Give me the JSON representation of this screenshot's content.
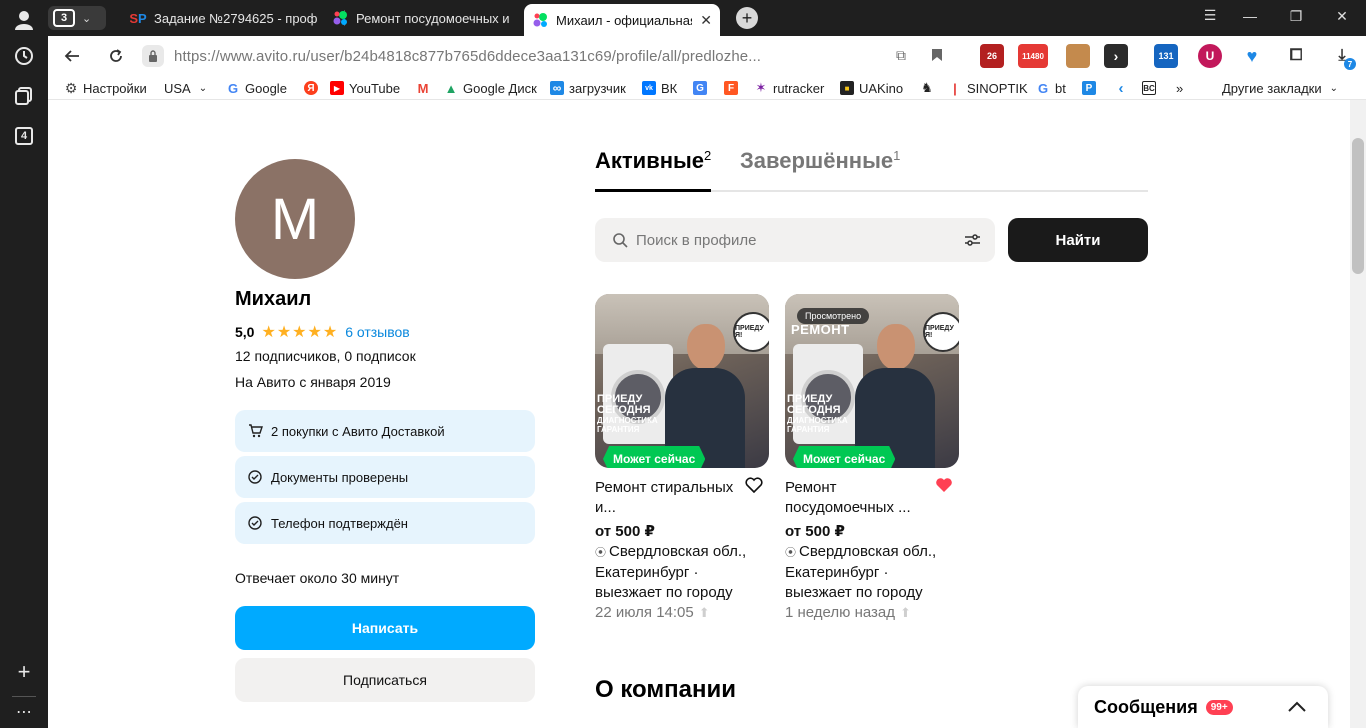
{
  "browser": {
    "sidebar": {
      "tab_group_count": "4"
    },
    "tab_count": "3",
    "tabs": [
      {
        "title": "Задание №2794625 - проф",
        "favicon": "SP"
      },
      {
        "title": "Ремонт посудомоечных и",
        "favicon": "avito"
      },
      {
        "title": "Михаил - официальная с",
        "favicon": "avito",
        "close": "✕"
      }
    ],
    "url": "https://www.avito.ru/user/b24b4818c877b765d6ddece3aa131c69/profile/all/predlozhe...",
    "extensions": [
      {
        "name": "badge-26",
        "text": "26",
        "color": "#b32020"
      },
      {
        "name": "badge-11480",
        "text": "11480",
        "color": "#e53935"
      },
      {
        "name": "ext-box",
        "text": "",
        "color": "#c48a4d"
      },
      {
        "name": "ext-arrow",
        "text": "›",
        "color": "#2b2b2b"
      },
      {
        "name": "ext-calendar",
        "text": "131",
        "color": "#1565c0"
      },
      {
        "name": "ext-ublock",
        "text": "U",
        "color": "#c2185b"
      },
      {
        "name": "ext-heart",
        "text": "♥",
        "color": "#1e88e5"
      },
      {
        "name": "ext-puzzle",
        "text": "",
        "color": "#333333"
      },
      {
        "name": "ext-download",
        "text": "7",
        "color": "#1e88e5"
      }
    ],
    "bookmarks": [
      {
        "label": "Настройки",
        "icon": "gear",
        "color": "#444444"
      },
      {
        "label": "USA",
        "icon": "",
        "color": "#ffffff"
      },
      {
        "label": "Google",
        "icon": "G",
        "color": "#4285f4"
      },
      {
        "label": "",
        "icon": "Я",
        "color": "#fc3f1d"
      },
      {
        "label": "YouTube",
        "icon": "▶",
        "color": "#ff0000"
      },
      {
        "label": "",
        "icon": "M",
        "color": "#ea4335"
      },
      {
        "label": "Google Диск",
        "icon": "▲",
        "color": "#1fa463"
      },
      {
        "label": "загрузчик",
        "icon": "∞",
        "color": "#1e88e5"
      },
      {
        "label": "ВК",
        "icon": "vk",
        "color": "#0077ff"
      },
      {
        "label": "",
        "icon": "G",
        "color": "#4285f4"
      },
      {
        "label": "",
        "icon": "F",
        "color": "#ff5722"
      },
      {
        "label": "rutracker",
        "icon": "✶",
        "color": "#7b1fa2"
      },
      {
        "label": "UAKino",
        "icon": "■",
        "color": "#222222"
      },
      {
        "label": "",
        "icon": "♞",
        "color": "#222222"
      },
      {
        "label": "SINOPTIK",
        "icon": "|",
        "color": "#e53935"
      },
      {
        "label": "bt",
        "icon": "G",
        "color": "#4285f4"
      },
      {
        "label": "",
        "icon": "P",
        "color": "#1e88e5"
      },
      {
        "label": "",
        "icon": "‹",
        "color": "#1e88e5"
      },
      {
        "label": "",
        "icon": "BC",
        "color": "#222222"
      },
      {
        "label": "»",
        "icon": "",
        "color": "#ffffff"
      }
    ],
    "other_bookmarks": "Другие закладки"
  },
  "profile": {
    "avatar_letter": "М",
    "name": "Михаил",
    "rating": "5,0",
    "reviews": "6 отзывов",
    "subscribers": "12 подписчиков, 0 подписок",
    "since": "На Авито с января 2019",
    "badges": [
      {
        "text": "2 покупки с Авито Доставкой",
        "icon": "cart-icon"
      },
      {
        "text": "Документы проверены",
        "icon": "check-icon"
      },
      {
        "text": "Телефон подтверждён",
        "icon": "check-icon"
      }
    ],
    "response": "Отвечает около 30 минут",
    "write_label": "Написать",
    "subscribe_label": "Подписаться"
  },
  "listing": {
    "tab_active": "Активные",
    "tab_active_count": "2",
    "tab_done": "Завершённые",
    "tab_done_count": "1",
    "search_placeholder": "Поиск в профиле",
    "find_label": "Найти",
    "cards": [
      {
        "title": "Ремонт стиральных и...",
        "price": "от 500 ₽",
        "location": "Свердловская обл., Екатеринбург · выезжает по городу",
        "date": "22 июля 14:05",
        "badge": "Может сейчас",
        "viewed": "",
        "favorited": false,
        "image_text": [
          "ПРИЕДУ",
          "СЕГОДНЯ",
          "ДИАГНОСТИКА",
          "ГАРАНТИЯ"
        ],
        "image_banner": "",
        "circle": "ПРИЕДУ Я!"
      },
      {
        "title": "Ремонт посудомоечных ...",
        "price": "от 500 ₽",
        "location": "Свердловская обл., Екатеринбург · выезжает по городу",
        "date": "1 неделю назад",
        "badge": "Может сейчас",
        "viewed": "Просмотрено",
        "favorited": true,
        "image_text": [
          "ПРИЕДУ",
          "СЕГОДНЯ",
          "ДИАГНОСТИКА",
          "ГАРАНТИЯ"
        ],
        "image_banner": "РЕМОНТ",
        "circle": "ПРИЕДУ Я!"
      }
    ],
    "about_heading": "О компании"
  },
  "messenger": {
    "label": "Сообщения",
    "count": "99+"
  },
  "colors": {
    "accent_blue": "#00aaff",
    "star": "#ffb021",
    "green_badge": "#00c853",
    "heart_active": "#ff4053",
    "chip_bg": "#e6f4fd"
  }
}
